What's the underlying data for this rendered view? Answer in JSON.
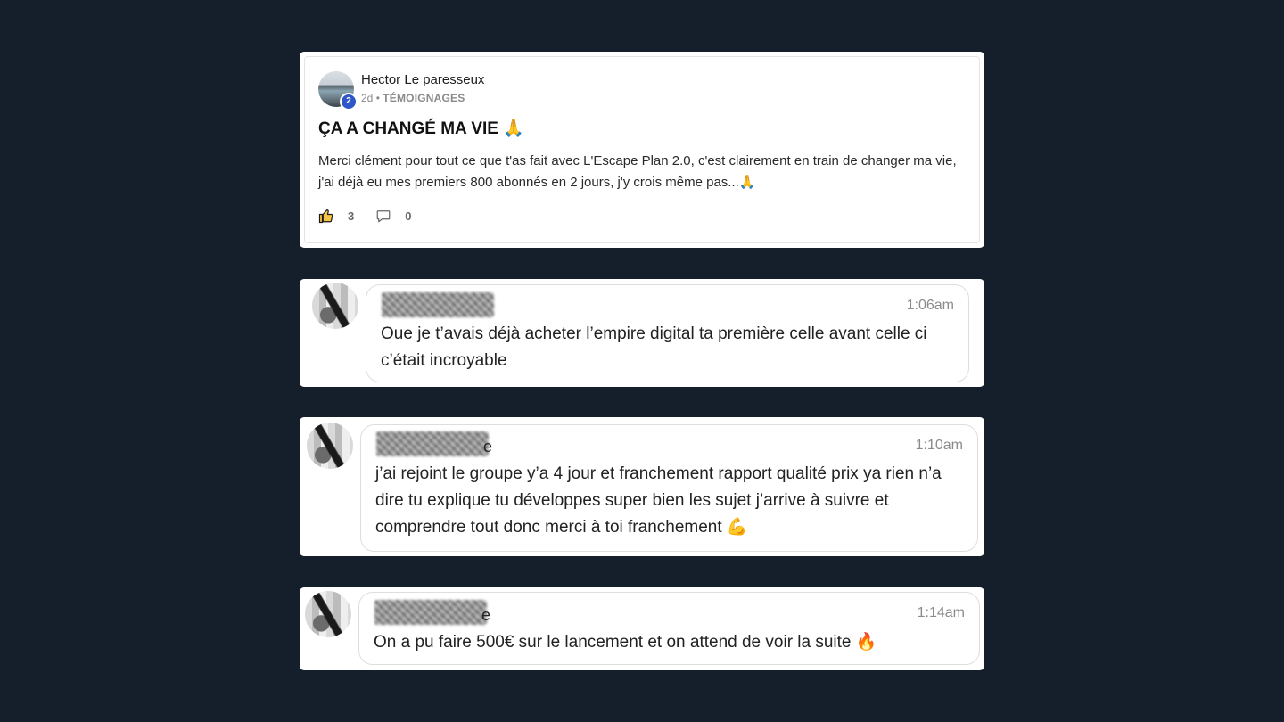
{
  "post": {
    "author": "Hector Le paresseux",
    "level": "2",
    "age": "2d",
    "separator": "•",
    "category": "TÉMOIGNAGES",
    "title": "ÇA A CHANGÉ MA VIE 🙏",
    "body": "Merci clément pour tout ce que t'as fait avec L'Escape Plan 2.0, c'est clairement en train de changer ma vie, j'ai déjà eu mes premiers 800 abonnés en 2 jours, j'y crois même pas...🙏",
    "likes": "3",
    "comments": "0",
    "like_icon": "thumbs-up-icon",
    "comment_icon": "comment-icon"
  },
  "messages": [
    {
      "name_suffix": "",
      "time": "1:06am",
      "text": "Oue je t’avais déjà acheter l’empire digital ta première celle avant celle ci c’était incroyable"
    },
    {
      "name_suffix": "e",
      "time": "1:10am",
      "text": "j’ai rejoint le groupe y’a 4 jour et franchement rapport qualité prix ya rien n’a dire tu explique tu développes super bien les sujet j’arrive à suivre et comprendre tout donc merci à toi franchement 💪"
    },
    {
      "name_suffix": "e",
      "time": "1:14am",
      "text": "On a pu faire 500€ sur le lancement et on attend de voir la suite 🔥"
    }
  ],
  "colors": {
    "background": "#141f2b",
    "card": "#ffffff",
    "badge": "#2f56c8",
    "muted": "#8a8a8a"
  }
}
